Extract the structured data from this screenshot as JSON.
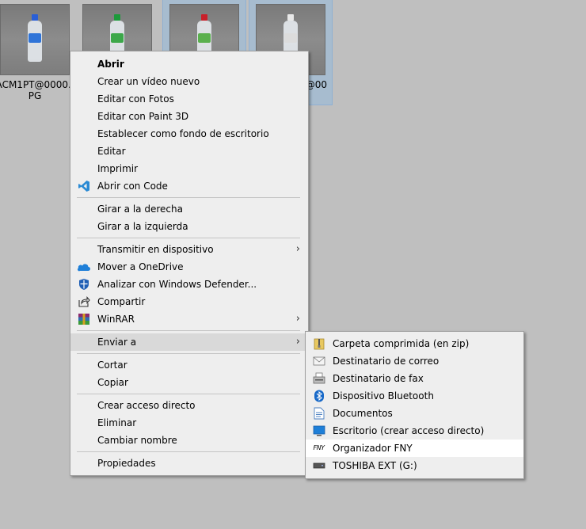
{
  "desktop": {
    "files": [
      {
        "name": "ACM1PT@0000.JPG",
        "selected": false,
        "cap_color": "#2a5fd6",
        "label_color": "#2f74d8"
      },
      {
        "name": "",
        "selected": false,
        "cap_color": "#1c9a3a",
        "label_color": "#3ca84a"
      },
      {
        "name": "",
        "selected": true,
        "cap_color": "#c8202a",
        "label_color": "#5ab04e"
      },
      {
        "name": "@00",
        "selected": true,
        "cap_color": "#e8e8e8",
        "label_color": "#dcdcdc"
      }
    ]
  },
  "context_menu": {
    "items": [
      {
        "label": "Abrir"
      },
      {
        "label": "Crear un vídeo nuevo"
      },
      {
        "label": "Editar con Fotos"
      },
      {
        "label": "Editar con Paint 3D"
      },
      {
        "label": "Establecer como fondo de escritorio"
      },
      {
        "label": "Editar"
      },
      {
        "label": "Imprimir"
      },
      {
        "label": "Abrir con Code",
        "icon": "vscode-icon"
      },
      {
        "label": "Girar a la derecha"
      },
      {
        "label": "Girar a la izquierda"
      },
      {
        "label": "Transmitir en dispositivo"
      },
      {
        "label": "Mover a OneDrive",
        "icon": "onedrive-icon"
      },
      {
        "label": "Analizar con Windows Defender...",
        "icon": "windows-defender-icon"
      },
      {
        "label": "Compartir",
        "icon": "share-icon"
      },
      {
        "label": "WinRAR",
        "icon": "winrar-icon"
      },
      {
        "label": "Enviar a"
      },
      {
        "label": "Cortar"
      },
      {
        "label": "Copiar"
      },
      {
        "label": "Crear acceso directo"
      },
      {
        "label": "Eliminar"
      },
      {
        "label": "Cambiar nombre"
      },
      {
        "label": "Propiedades"
      }
    ]
  },
  "send_to_menu": {
    "items": [
      {
        "label": "Carpeta comprimida (en zip)",
        "icon": "zip-folder-icon"
      },
      {
        "label": "Destinatario de correo",
        "icon": "mail-recipient-icon"
      },
      {
        "label": "Destinatario de fax",
        "icon": "fax-icon"
      },
      {
        "label": "Dispositivo Bluetooth",
        "icon": "bluetooth-icon"
      },
      {
        "label": "Documentos",
        "icon": "documents-icon"
      },
      {
        "label": "Escritorio (crear acceso directo)",
        "icon": "desktop-icon"
      },
      {
        "label": "Organizador FNY",
        "icon": "fny-icon",
        "icon_text": "FNY"
      },
      {
        "label": "TOSHIBA EXT (G:)",
        "icon": "drive-icon"
      }
    ]
  },
  "colors": {
    "background": "#bfbfbf",
    "menu_bg": "#eeeeee",
    "selection": "#a7bccf",
    "vscode_blue": "#2a8ad4",
    "onedrive_blue": "#1e7fd8"
  }
}
